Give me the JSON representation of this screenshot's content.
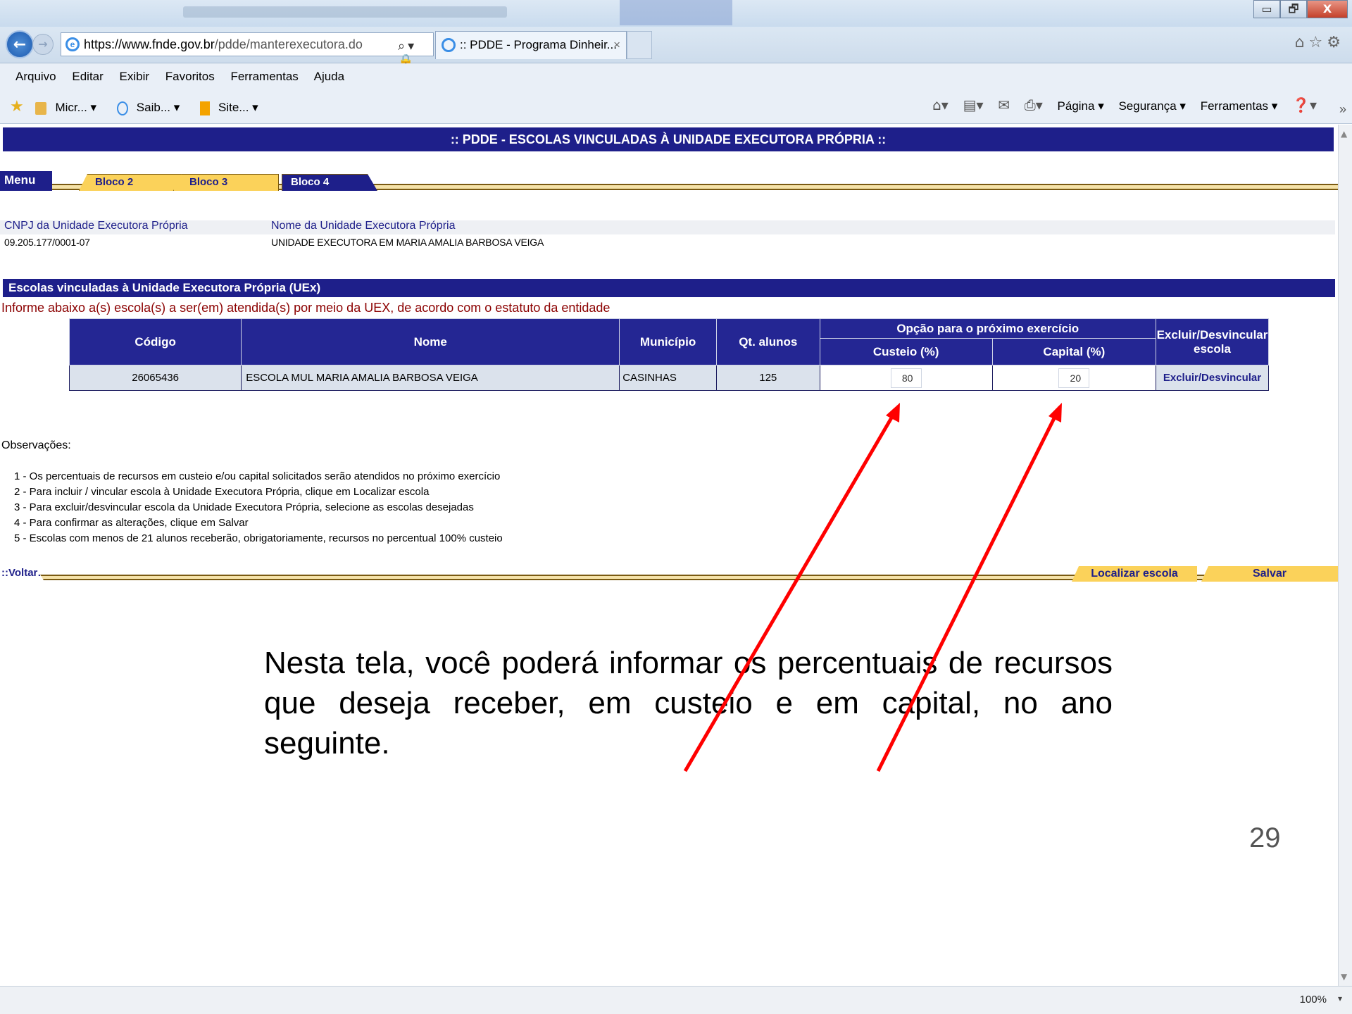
{
  "browser": {
    "window_controls": {
      "minimize": "▭",
      "maximize": "🗗",
      "close": "X"
    },
    "address_host": "https://www.fnde.gov.br",
    "address_path": "/pdde/manterexecutora.do",
    "tab_title": ":: PDDE - Programa Dinheir...",
    "tab_close": "×",
    "menu": [
      "Arquivo",
      "Editar",
      "Exibir",
      "Favoritos",
      "Ferramentas",
      "Ajuda"
    ],
    "favorites": [
      "Micr... ▾",
      "Saib... ▾",
      "Site... ▾"
    ],
    "command_bar": [
      "Página ▾",
      "Segurança ▾",
      "Ferramentas ▾"
    ],
    "zoom": "100%"
  },
  "page": {
    "header": ":: PDDE - ESCOLAS VINCULADAS À UNIDADE EXECUTORA PRÓPRIA ::",
    "tabs": {
      "menu": "Menu",
      "bloco2": "Bloco 2",
      "bloco3": "Bloco 3",
      "bloco4": "Bloco 4"
    },
    "cnpj_label": "CNPJ da Unidade Executora Própria",
    "cnpj_value": "09.205.177/0001-07",
    "nome_label": "Nome da Unidade Executora Própria",
    "nome_value": "UNIDADE EXECUTORA EM MARIA AMALIA BARBOSA VEIGA",
    "section_title": "Escolas vinculadas à Unidade Executora Própria (UEx)",
    "instruction": "Informe abaixo a(s) escola(s) a ser(em) atendida(s) por meio da UEX, de acordo com o estatuto da entidade",
    "table": {
      "group_header": "Opção para o próximo exercício",
      "columns": {
        "codigo": "Código",
        "nome": "Nome",
        "municipio": "Município",
        "qt_alunos": "Qt. alunos",
        "custeio": "Custeio (%)",
        "capital": "Capital (%)",
        "excluir": "Excluir/Desvincular escola"
      },
      "rows": [
        {
          "codigo": "26065436",
          "nome": "ESCOLA MUL MARIA AMALIA BARBOSA VEIGA",
          "municipio": "CASINHAS",
          "qt_alunos": "125",
          "custeio": "80",
          "capital": "20",
          "acao": "Excluir/Desvincular"
        }
      ]
    },
    "observacoes_title": "Observações:",
    "observacoes": [
      "1 - Os percentuais de recursos em custeio e/ou capital solicitados serão atendidos no próximo exercício",
      "2 - Para incluir / vincular escola à Unidade Executora Própria, clique em Localizar escola",
      "3 - Para excluir/desvincular escola da Unidade Executora Própria, selecione as escolas desejadas",
      "4 - Para confirmar as alterações, clique em Salvar",
      "5 - Escolas com menos de 21 alunos receberão, obrigatoriamente, recursos no percentual 100% custeio"
    ],
    "footer": {
      "voltar": "::Voltar::",
      "localizar": "Localizar escola",
      "salvar": "Salvar"
    }
  },
  "annotation": {
    "text": "Nesta tela, você poderá informar os percentuais de recursos que deseja receber, em custeio e em capital, no ano seguinte.",
    "arrow_color": "#ff0000"
  },
  "slide_number": "29"
}
